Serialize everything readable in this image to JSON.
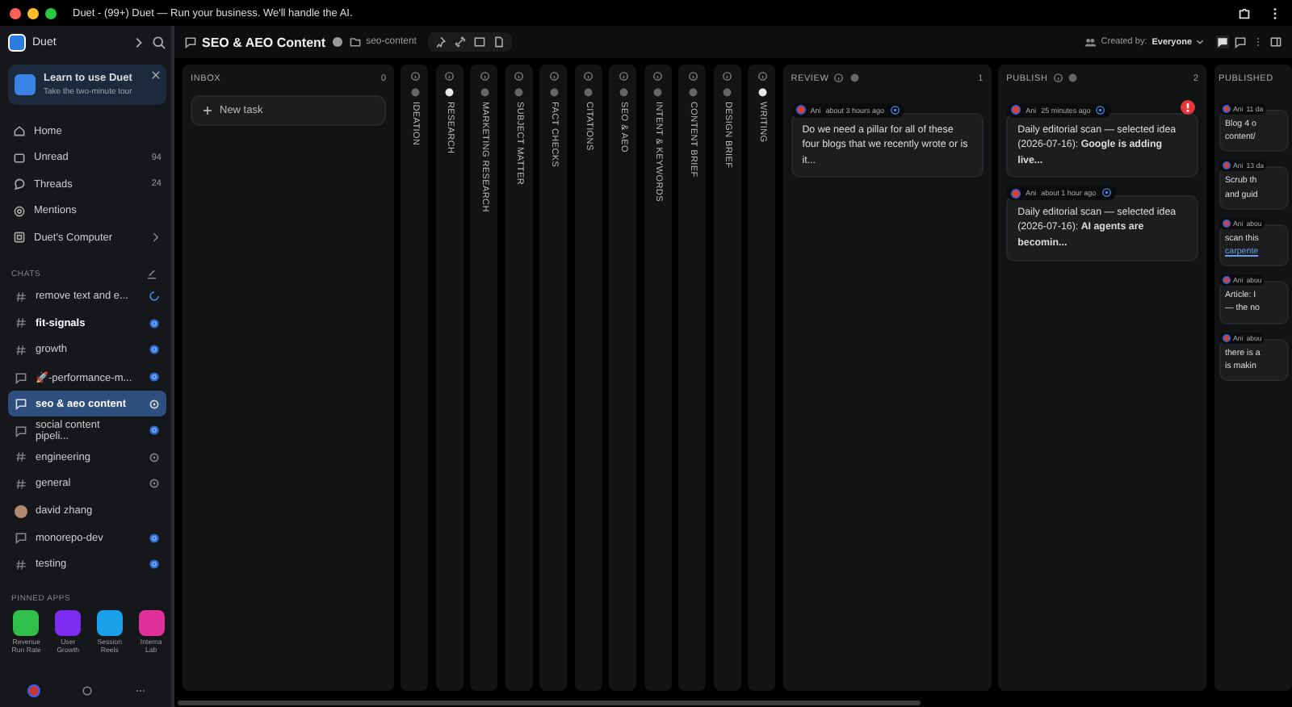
{
  "window": {
    "title": "Duet - (99+) Duet — Run your business. We'll handle the AI."
  },
  "sidebar": {
    "workspace": "Duet",
    "promo": {
      "title": "Learn to use Duet",
      "subtitle": "Take the two-minute tour"
    },
    "nav": [
      {
        "label": "Home",
        "chevron": false
      },
      {
        "label": "Unread",
        "count": "94",
        "chevron": false
      },
      {
        "label": "Threads",
        "count": "24",
        "chevron": false
      },
      {
        "label": "Mentions",
        "chevron": false
      },
      {
        "label": "Duet's Computer",
        "chevron": true
      }
    ],
    "chats_heading": "CHATS",
    "chats": [
      {
        "label": "remove text and e...",
        "kind": "channel",
        "syncing": true,
        "active": true,
        "selected": false,
        "unread": false
      },
      {
        "label": "fit-signals",
        "kind": "channel",
        "syncing": false,
        "active": true,
        "selected": false,
        "unread": true
      },
      {
        "label": "growth",
        "kind": "channel",
        "syncing": false,
        "active": true,
        "selected": false,
        "unread": false
      },
      {
        "label": "🚀-performance-m...",
        "kind": "thread",
        "syncing": false,
        "active": true,
        "selected": false,
        "unread": false
      },
      {
        "label": "seo & aeo content",
        "kind": "thread",
        "syncing": false,
        "active": false,
        "selected": true,
        "unread": false
      },
      {
        "label": "social content pipeli...",
        "kind": "thread",
        "syncing": false,
        "active": true,
        "selected": false,
        "unread": false
      },
      {
        "label": "engineering",
        "kind": "channel",
        "syncing": false,
        "active": false,
        "selected": false,
        "unread": false
      },
      {
        "label": "general",
        "kind": "channel",
        "syncing": false,
        "active": false,
        "selected": false,
        "unread": false
      },
      {
        "label": "david zhang",
        "kind": "person",
        "selected": false,
        "unread": false
      },
      {
        "label": "monorepo-dev",
        "kind": "thread",
        "syncing": false,
        "active": true,
        "selected": false,
        "unread": false
      },
      {
        "label": "testing",
        "kind": "channel",
        "syncing": false,
        "active": true,
        "selected": false,
        "unread": false
      }
    ],
    "pinned_heading": "PINNED APPS",
    "pinned_apps": [
      {
        "label": "Revenue Run Rate",
        "color": "#2fbf4a"
      },
      {
        "label": "User Growth",
        "color": "#7a2cf0"
      },
      {
        "label": "Session Reels",
        "color": "#1aa0e8"
      },
      {
        "label": "Interna Lab",
        "color": "#e0309a"
      }
    ]
  },
  "header": {
    "title": "SEO & AEO Content",
    "folder": "seo-content",
    "filter_label": "Created by:",
    "filter_value": "Everyone"
  },
  "inbox": {
    "title": "INBOX",
    "count": "0",
    "new_task": "New task"
  },
  "stages": [
    {
      "label": "IDEATION",
      "highlighted": false
    },
    {
      "label": "RESEARCH",
      "highlighted": true
    },
    {
      "label": "MARKETING RESEARCH",
      "highlighted": false
    },
    {
      "label": "SUBJECT MATTER",
      "highlighted": false
    },
    {
      "label": "FACT CHECKS",
      "highlighted": false
    },
    {
      "label": "CITATIONS",
      "highlighted": false
    },
    {
      "label": "SEO & AEO",
      "highlighted": false
    },
    {
      "label": "INTENT & KEYWORDS",
      "highlighted": false
    },
    {
      "label": "CONTENT BRIEF",
      "highlighted": false
    },
    {
      "label": "DESIGN BRIEF",
      "highlighted": false
    },
    {
      "label": "WRITING",
      "highlighted": true
    }
  ],
  "lanes": [
    {
      "title": "REVIEW",
      "count": "1",
      "cards": [
        {
          "author": "Ani",
          "time": "about 3 hours ago",
          "alert": false,
          "text": "Do we need a pillar for all of these four blogs that we recently wrote or is it..."
        }
      ]
    },
    {
      "title": "PUBLISH",
      "count": "2",
      "cards": [
        {
          "author": "Ani",
          "time": "25 minutes ago",
          "alert": true,
          "text": "Daily editorial scan — selected idea (2026-07-16): **Google is adding live...**"
        },
        {
          "author": "Ani",
          "time": "about 1 hour ago",
          "alert": false,
          "text": "Daily editorial scan — selected idea (2026-07-16): **AI agents are becomin...**"
        }
      ]
    }
  ],
  "published": {
    "title": "PUBLISHED",
    "cards": [
      {
        "author": "Ani",
        "time": "11 da",
        "lines": [
          "Blog 4 o",
          "content/"
        ],
        "link": false
      },
      {
        "author": "Ani",
        "time": "13 da",
        "lines": [
          "Scrub th",
          "and guid"
        ],
        "link": false
      },
      {
        "author": "Ani",
        "time": "abou",
        "lines": [
          "scan this",
          "carpente"
        ],
        "link": true
      },
      {
        "author": "Ani",
        "time": "abou",
        "lines": [
          "Article: I",
          "— the no"
        ],
        "link": false
      },
      {
        "author": "Ani",
        "time": "abou",
        "lines": [
          "there is a",
          "is makin"
        ],
        "link": false
      }
    ]
  }
}
